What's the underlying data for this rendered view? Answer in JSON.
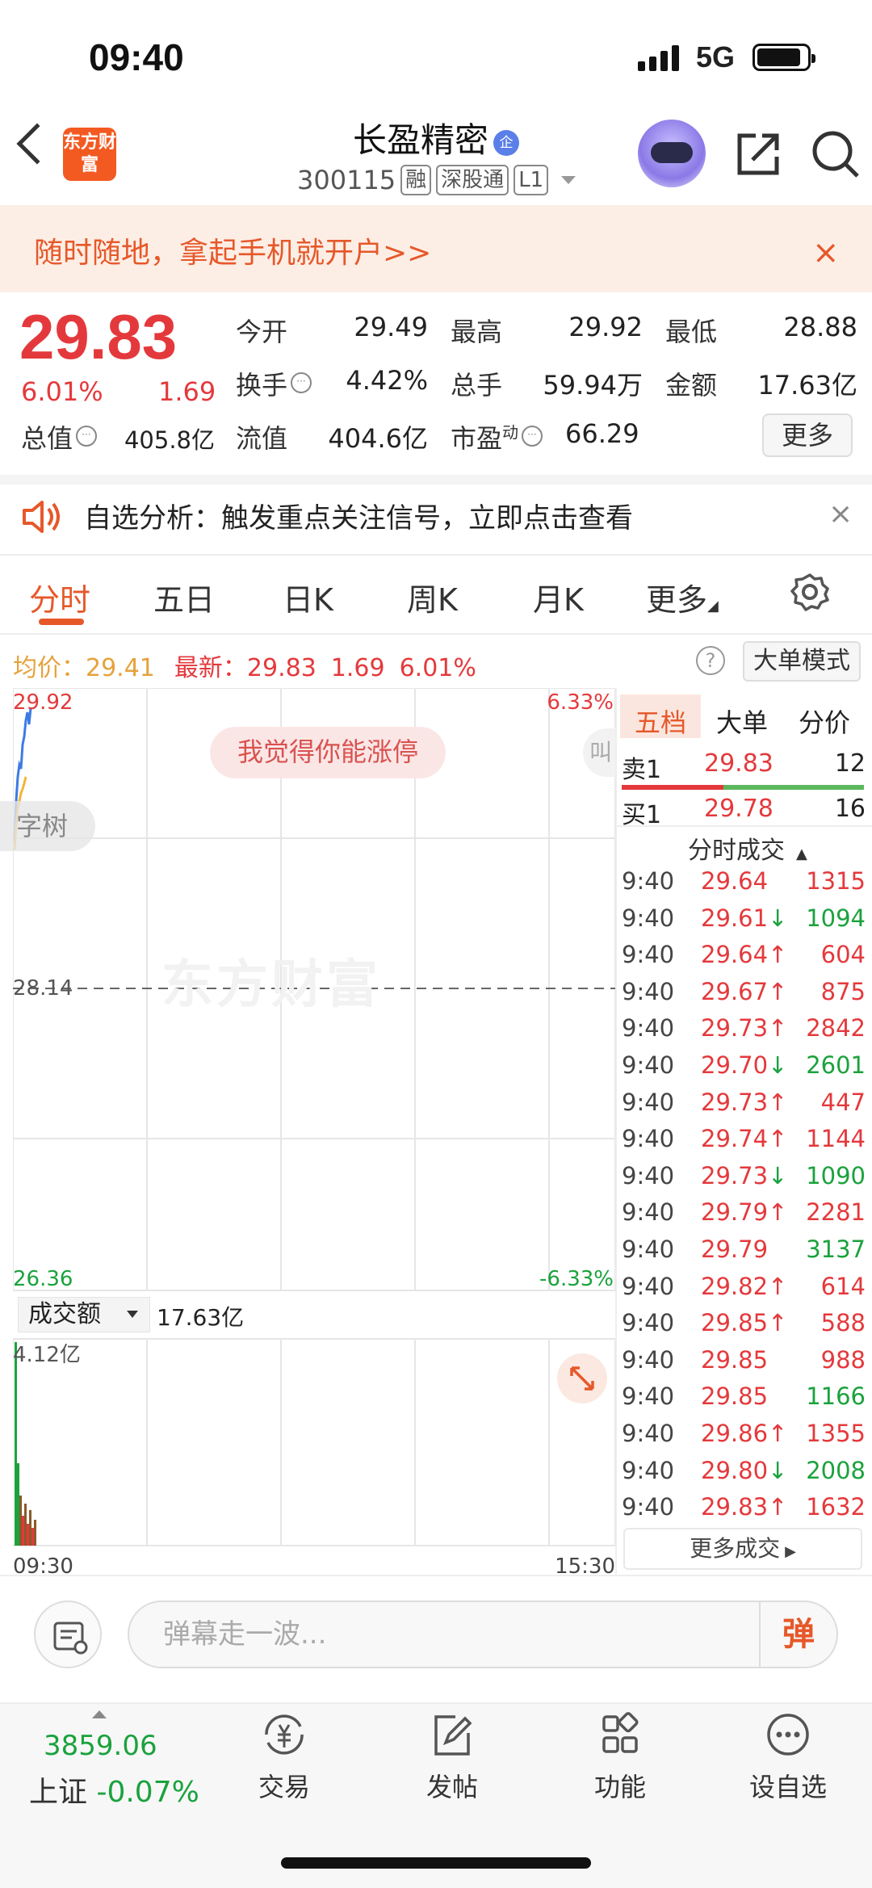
{
  "status_bar": {
    "time": "09:40",
    "network": "5G"
  },
  "header": {
    "logo_text": "东方财富",
    "stock_name": "长盈精密",
    "badge": "企",
    "code": "300115",
    "tags": [
      "融",
      "深股通",
      "L1"
    ]
  },
  "banner": {
    "text": "随时随地，拿起手机就开户>>",
    "close": "×"
  },
  "quote": {
    "price": "29.83",
    "change_pct": "6.01%",
    "change": "1.69",
    "open_label": "今开",
    "open": "29.49",
    "high_label": "最高",
    "high": "29.92",
    "low_label": "最低",
    "low": "28.88",
    "turnover_label": "换手",
    "turnover": "4.42%",
    "volume_label": "总手",
    "volume": "59.94万",
    "amount_label": "金额",
    "amount": "17.63亿",
    "mktcap_label": "总值",
    "mktcap": "405.8亿",
    "float_label": "流值",
    "float": "404.6亿",
    "pe_label": "市盈",
    "pe_sup": "动",
    "pe": "66.29",
    "more": "更多",
    "dots": "···"
  },
  "notice": {
    "text": "自选分析：触发重点关注信号，立即点击查看",
    "close": "×"
  },
  "tabs": [
    "分时",
    "五日",
    "日K",
    "周K",
    "月K",
    "更多"
  ],
  "avg_row": {
    "avg_label": "均价：",
    "avg": "29.41",
    "latest_label": "最新：",
    "latest": "29.83",
    "change": "1.69",
    "pct": "6.01%",
    "help": "?",
    "big_order": "大单模式"
  },
  "chart": {
    "y_high": "29.92",
    "y_high_pct": "6.33%",
    "y_mid": "28.14",
    "y_low": "26.36",
    "y_low_pct": "-6.33%",
    "danmu": "我觉得你能涨停",
    "side_bubble": "字树",
    "right_bubble": "叫",
    "watermark": "东方财富",
    "x_start": "09:30",
    "x_end": "15:30"
  },
  "volume": {
    "dropdown": "成交额",
    "total": "17.63亿",
    "max": "4.12亿"
  },
  "right_panel": {
    "tabs": [
      "五档",
      "大单",
      "分价"
    ],
    "ask1": {
      "label": "卖1",
      "price": "29.83",
      "qty": "12"
    },
    "bid1": {
      "label": "买1",
      "price": "29.78",
      "qty": "16"
    },
    "trades_title": "分时成交",
    "more_trades": "更多成交",
    "trades": [
      {
        "time": "9:40",
        "price": "29.64",
        "dir": "",
        "qty": "1315",
        "color": "red"
      },
      {
        "time": "9:40",
        "price": "29.61↓",
        "dir": "",
        "qty": "1094",
        "color": "green"
      },
      {
        "time": "9:40",
        "price": "29.64↑",
        "dir": "",
        "qty": "604",
        "color": "red"
      },
      {
        "time": "9:40",
        "price": "29.67↑",
        "dir": "",
        "qty": "875",
        "color": "red"
      },
      {
        "time": "9:40",
        "price": "29.73↑",
        "dir": "",
        "qty": "2842",
        "color": "red"
      },
      {
        "time": "9:40",
        "price": "29.70↓",
        "dir": "",
        "qty": "2601",
        "color": "green"
      },
      {
        "time": "9:40",
        "price": "29.73↑",
        "dir": "",
        "qty": "447",
        "color": "red"
      },
      {
        "time": "9:40",
        "price": "29.74↑",
        "dir": "",
        "qty": "1144",
        "color": "red"
      },
      {
        "time": "9:40",
        "price": "29.73↓",
        "dir": "",
        "qty": "1090",
        "color": "green"
      },
      {
        "time": "9:40",
        "price": "29.79↑",
        "dir": "",
        "qty": "2281",
        "color": "red"
      },
      {
        "time": "9:40",
        "price": "29.79",
        "dir": "",
        "qty": "3137",
        "color": "green"
      },
      {
        "time": "9:40",
        "price": "29.82↑",
        "dir": "",
        "qty": "614",
        "color": "red"
      },
      {
        "time": "9:40",
        "price": "29.85↑",
        "dir": "",
        "qty": "588",
        "color": "red"
      },
      {
        "time": "9:40",
        "price": "29.85",
        "dir": "",
        "qty": "988",
        "color": "red"
      },
      {
        "time": "9:40",
        "price": "29.85",
        "dir": "",
        "qty": "1166",
        "color": "green"
      },
      {
        "time": "9:40",
        "price": "29.86↑",
        "dir": "",
        "qty": "1355",
        "color": "red"
      },
      {
        "time": "9:40",
        "price": "29.80↓",
        "dir": "",
        "qty": "2008",
        "color": "green"
      },
      {
        "time": "9:40",
        "price": "29.83↑",
        "dir": "",
        "qty": "1632",
        "color": "red"
      }
    ]
  },
  "comment_bar": {
    "placeholder": "弹幕走一波...",
    "danmu_btn": "弹"
  },
  "bottom_nav": {
    "index_value": "3859.06",
    "index_name": "上证",
    "index_pct": "-0.07%",
    "items": [
      "交易",
      "发帖",
      "功能",
      "设自选"
    ]
  },
  "colors": {
    "up": "#e4393c",
    "down": "#1ba23d",
    "accent": "#e6582a"
  }
}
